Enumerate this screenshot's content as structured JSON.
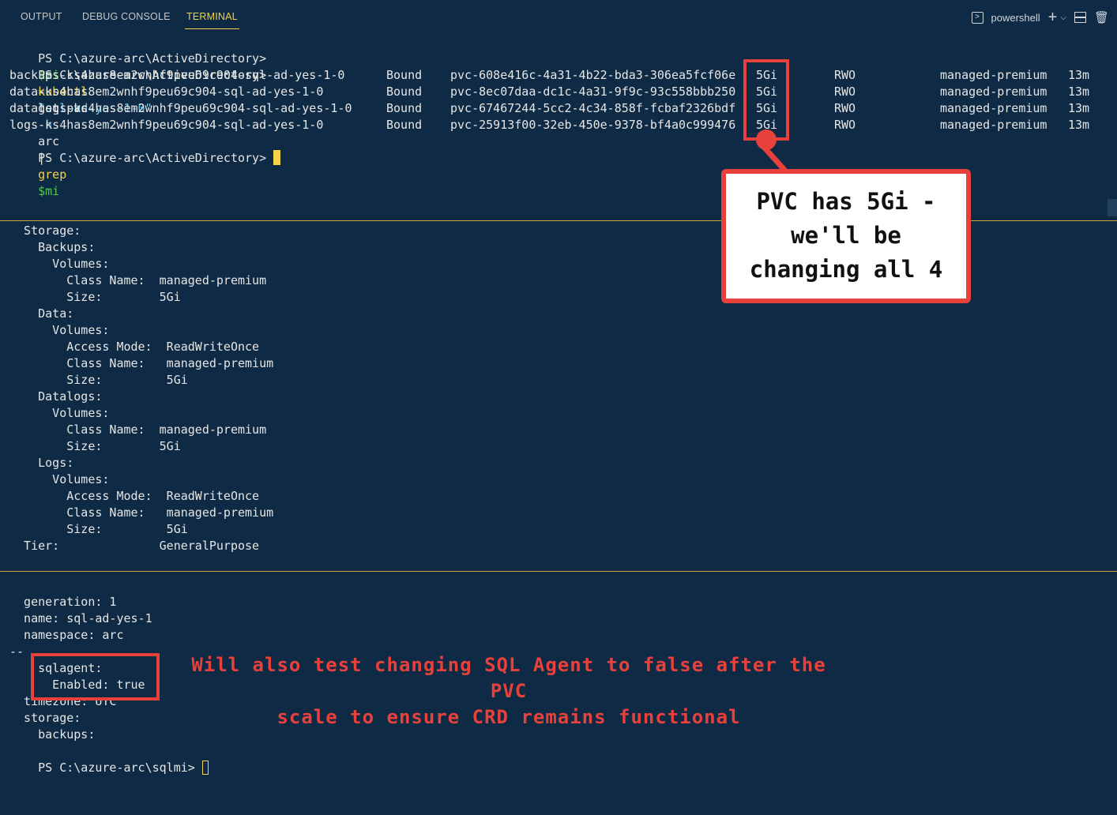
{
  "tabs": {
    "output": "OUTPUT",
    "debug": "DEBUG CONSOLE",
    "terminal": "TERMINAL"
  },
  "toolbar": {
    "shell": "powershell",
    "add": "+",
    "chevron": "⌵",
    "icons": [
      "terminal-icon",
      "plus-icon",
      "chevron-down-icon",
      "split-icon",
      "trash-icon"
    ]
  },
  "pane1": {
    "prompt": "PS C:\\azure-arc\\ActiveDirectory>",
    "cmd1": {
      "var": "$mi",
      "eq": "=",
      "str": "\"sql-ad-yes-1-0\""
    },
    "cmd2": {
      "kubectl": "kubectl",
      "args": "get pvc",
      "flag": "-n",
      "ns": "arc",
      "pipe": "|",
      "grep": "grep",
      "var": "$mi"
    },
    "rows": [
      {
        "name": "backups-ks4has8em2wnhf9peu69c904-sql-ad-yes-1-0",
        "status": "Bound",
        "volume": "pvc-608e416c-4a31-4b22-bda3-306ea5fcf06e",
        "cap": "5Gi",
        "mode": "RWO",
        "sc": "managed-premium",
        "age": "13m"
      },
      {
        "name": "data-ks4has8em2wnhf9peu69c904-sql-ad-yes-1-0",
        "status": "Bound",
        "volume": "pvc-8ec07daa-dc1c-4a31-9f9c-93c558bbb250",
        "cap": "5Gi",
        "mode": "RWO",
        "sc": "managed-premium",
        "age": "13m"
      },
      {
        "name": "datalogs-ks4has8em2wnhf9peu69c904-sql-ad-yes-1-0",
        "status": "Bound",
        "volume": "pvc-67467244-5cc2-4c34-858f-fcbaf2326bdf",
        "cap": "5Gi",
        "mode": "RWO",
        "sc": "managed-premium",
        "age": "13m"
      },
      {
        "name": "logs-ks4has8em2wnhf9peu69c904-sql-ad-yes-1-0",
        "status": "Bound",
        "volume": "pvc-25913f00-32eb-450e-9378-bf4a0c999476",
        "cap": "5Gi",
        "mode": "RWO",
        "sc": "managed-premium",
        "age": "13m"
      }
    ]
  },
  "pane2": {
    "lines": [
      "  Storage:",
      "    Backups:",
      "      Volumes:",
      "        Class Name:  managed-premium",
      "        Size:        5Gi",
      "    Data:",
      "      Volumes:",
      "        Access Mode:  ReadWriteOnce",
      "        Class Name:   managed-premium",
      "        Size:         5Gi",
      "    Datalogs:",
      "      Volumes:",
      "        Class Name:  managed-premium",
      "        Size:        5Gi",
      "    Logs:",
      "      Volumes:",
      "        Access Mode:  ReadWriteOnce",
      "        Class Name:   managed-premium",
      "        Size:         5Gi",
      "  Tier:              GeneralPurpose"
    ]
  },
  "pane3": {
    "lines": [
      "  generation: 1",
      "  name: sql-ad-yes-1",
      "  namespace: arc",
      "--",
      "    sqlagent:",
      "      Enabled: true",
      "  timezone: UTC",
      "  storage:",
      "    backups:"
    ],
    "prompt": "PS C:\\azure-arc\\sqlmi>"
  },
  "callout": {
    "line1": "PVC has 5Gi -",
    "line2": "we'll be",
    "line3": "changing all 4"
  },
  "annotation": {
    "line1": "Will also test changing SQL Agent to false after the PVC",
    "line2": "scale to ensure CRD remains functional"
  },
  "colors": {
    "background": "#0f2a44",
    "accent": "#f2d34a",
    "highlight": "#e8413b"
  }
}
